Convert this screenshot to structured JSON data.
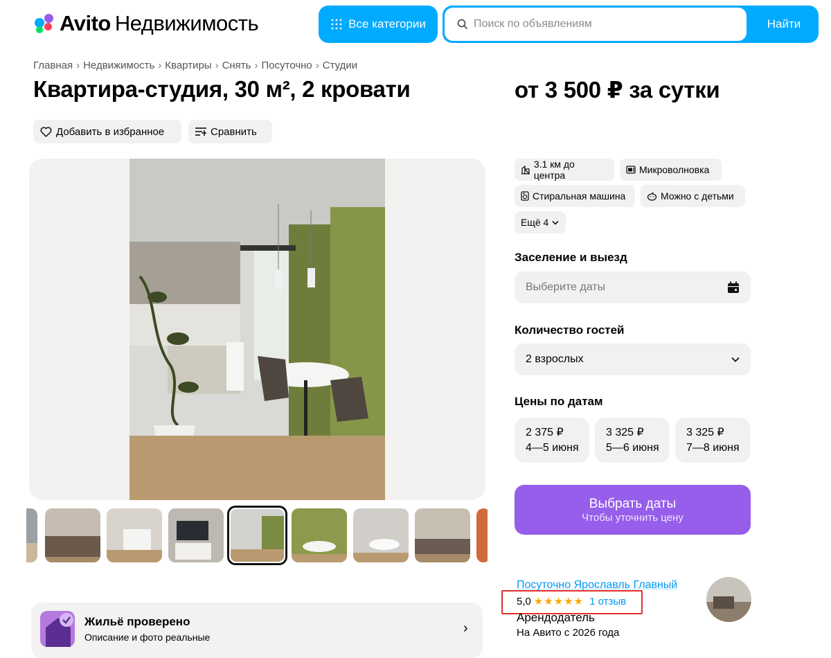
{
  "header": {
    "logo_brand": "Avito",
    "logo_section": "Недвижимость",
    "categories_label": "Все категории",
    "search_placeholder": "Поиск по объявлениям",
    "search_button": "Найти"
  },
  "breadcrumbs": [
    "Главная",
    "Недвижимость",
    "Квартиры",
    "Снять",
    "Посуточно",
    "Студии"
  ],
  "listing": {
    "title": "Квартира-студия, 30 м², 2 кровати",
    "price": "от 3 500 ₽ за сутки",
    "favorite_label": "Добавить в избранное",
    "compare_label": "Сравнить"
  },
  "amenities": [
    {
      "icon": "building-icon",
      "label": "3.1 км до центра"
    },
    {
      "icon": "microwave-icon",
      "label": "Микроволновка"
    },
    {
      "icon": "washer-icon",
      "label": "Стиральная машина"
    },
    {
      "icon": "baby-icon",
      "label": "Можно с детьми"
    }
  ],
  "more_label": "Ещё 4",
  "booking": {
    "checkin_label": "Заселение и выезд",
    "dates_placeholder": "Выберите даты",
    "guests_label": "Количество гостей",
    "guests_value": "2 взрослых",
    "prices_label": "Цены по датам",
    "date_prices": [
      {
        "price": "2 375 ₽",
        "dates": "4—5 июня"
      },
      {
        "price": "3 325 ₽",
        "dates": "5—6 июня"
      },
      {
        "price": "3 325 ₽",
        "dates": "7—8 июня"
      }
    ],
    "cta_title": "Выбрать даты",
    "cta_subtitle": "Чтобы уточнить цену"
  },
  "seller": {
    "name": "Посуточно Ярославль Главный",
    "rating": "5,0",
    "stars": "★★★★★",
    "reviews": "1 отзыв",
    "role": "Арендодатель",
    "since": "На Авито с 2026 года"
  },
  "verified": {
    "title": "Жильё проверено",
    "subtitle": "Описание и фото реальные"
  },
  "gallery": {
    "thumbnail_count": 8,
    "selected_thumbnail": 4
  },
  "colors": {
    "brand_blue": "#00aaff",
    "cta_purple": "#965eeb",
    "link_blue": "#0099f7",
    "star_orange": "#ffa800",
    "highlight_red": "#e0302b"
  }
}
